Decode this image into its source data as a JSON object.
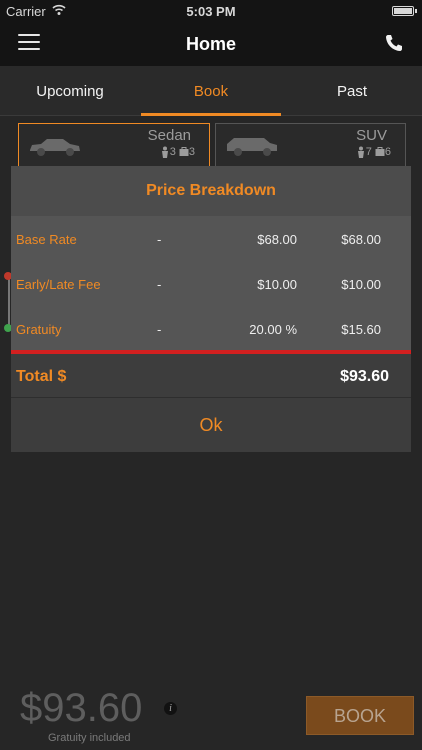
{
  "status_bar": {
    "carrier": "Carrier",
    "time": "5:03 PM"
  },
  "nav": {
    "title": "Home"
  },
  "tabs": [
    {
      "label": "Upcoming",
      "active": false
    },
    {
      "label": "Book",
      "active": true
    },
    {
      "label": "Past",
      "active": false
    }
  ],
  "vehicles": [
    {
      "name": "Sedan",
      "passengers": "3",
      "luggage": "3",
      "selected": true
    },
    {
      "name": "SUV",
      "passengers": "7",
      "luggage": "6",
      "selected": false
    }
  ],
  "modal": {
    "title": "Price Breakdown",
    "rows": [
      {
        "label": "Base Rate",
        "col2": "-",
        "col3": "$68.00",
        "col4": "$68.00"
      },
      {
        "label": "Early/Late Fee",
        "col2": "-",
        "col3": "$10.00",
        "col4": "$10.00"
      },
      {
        "label": "Gratuity",
        "col2": "-",
        "col3": "20.00 %",
        "col4": "$15.60"
      }
    ],
    "total_label": "Total $",
    "total_value": "$93.60",
    "ok_label": "Ok"
  },
  "footer": {
    "price": "$93.60",
    "gratuity_note": "Gratuity included",
    "book_label": "BOOK"
  },
  "colors": {
    "accent": "#f08a24",
    "divider": "#d32020",
    "background": "#262626"
  }
}
